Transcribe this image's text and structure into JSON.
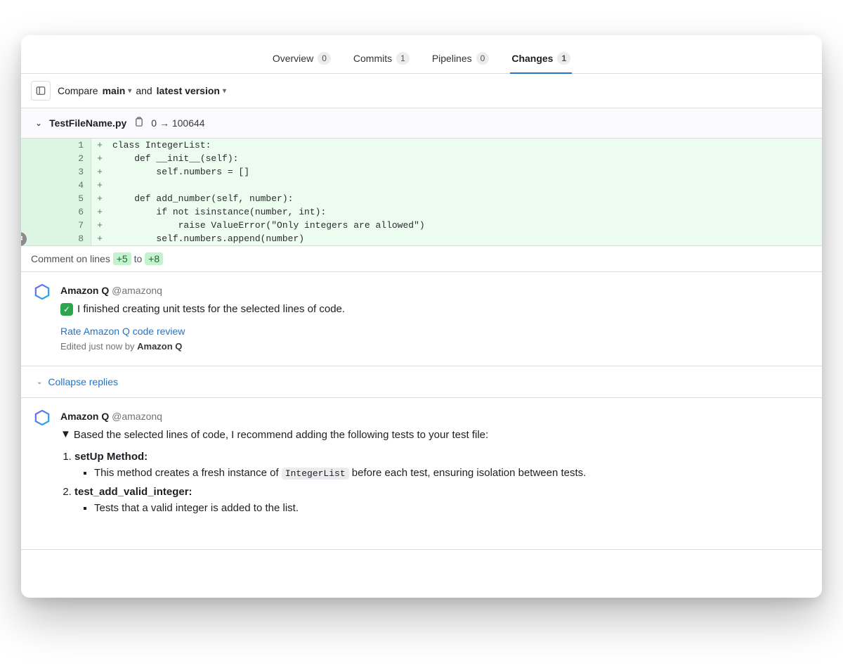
{
  "tabs": [
    {
      "label": "Overview",
      "count": "0",
      "active": false
    },
    {
      "label": "Commits",
      "count": "1",
      "active": false
    },
    {
      "label": "Pipelines",
      "count": "0",
      "active": false
    },
    {
      "label": "Changes",
      "count": "1",
      "active": true
    }
  ],
  "compare": {
    "label": "Compare",
    "base": "main",
    "joiner": "and",
    "target": "latest version"
  },
  "file": {
    "name": "TestFileName.py",
    "mode": "0 → 100644"
  },
  "diff_lines": [
    {
      "n": "1",
      "code": "class IntegerList:"
    },
    {
      "n": "2",
      "code": "    def __init__(self):"
    },
    {
      "n": "3",
      "code": "        self.numbers = []"
    },
    {
      "n": "4",
      "code": ""
    },
    {
      "n": "5",
      "code": "    def add_number(self, number):"
    },
    {
      "n": "6",
      "code": "        if not isinstance(number, int):"
    },
    {
      "n": "7",
      "code": "            raise ValueError(\"Only integers are allowed\")"
    },
    {
      "n": "8",
      "code": "        self.numbers.append(number)"
    }
  ],
  "comment_range": {
    "prefix": "Comment on lines",
    "from": "+5",
    "to_word": "to",
    "to": "+8"
  },
  "comment1": {
    "author": "Amazon Q",
    "handle": "@amazonq",
    "message": "I finished creating unit tests for the selected lines of code.",
    "link": "Rate Amazon Q code review",
    "meta_prefix": "Edited just now by ",
    "meta_author": "Amazon Q"
  },
  "collapse_label": "Collapse replies",
  "reply": {
    "author": "Amazon Q",
    "handle": "@amazonq",
    "intro": "Based the selected lines of code, I recommend adding the following tests to your test file:",
    "items": [
      {
        "title": "setUp Method:",
        "bullet_before": "This method creates a fresh instance of ",
        "bullet_code": "IntegerList",
        "bullet_after": " before each test, ensuring isolation between tests."
      },
      {
        "title": "test_add_valid_integer:",
        "bullet_before": "Tests that a valid integer is added to the list.",
        "bullet_code": "",
        "bullet_after": ""
      }
    ]
  }
}
